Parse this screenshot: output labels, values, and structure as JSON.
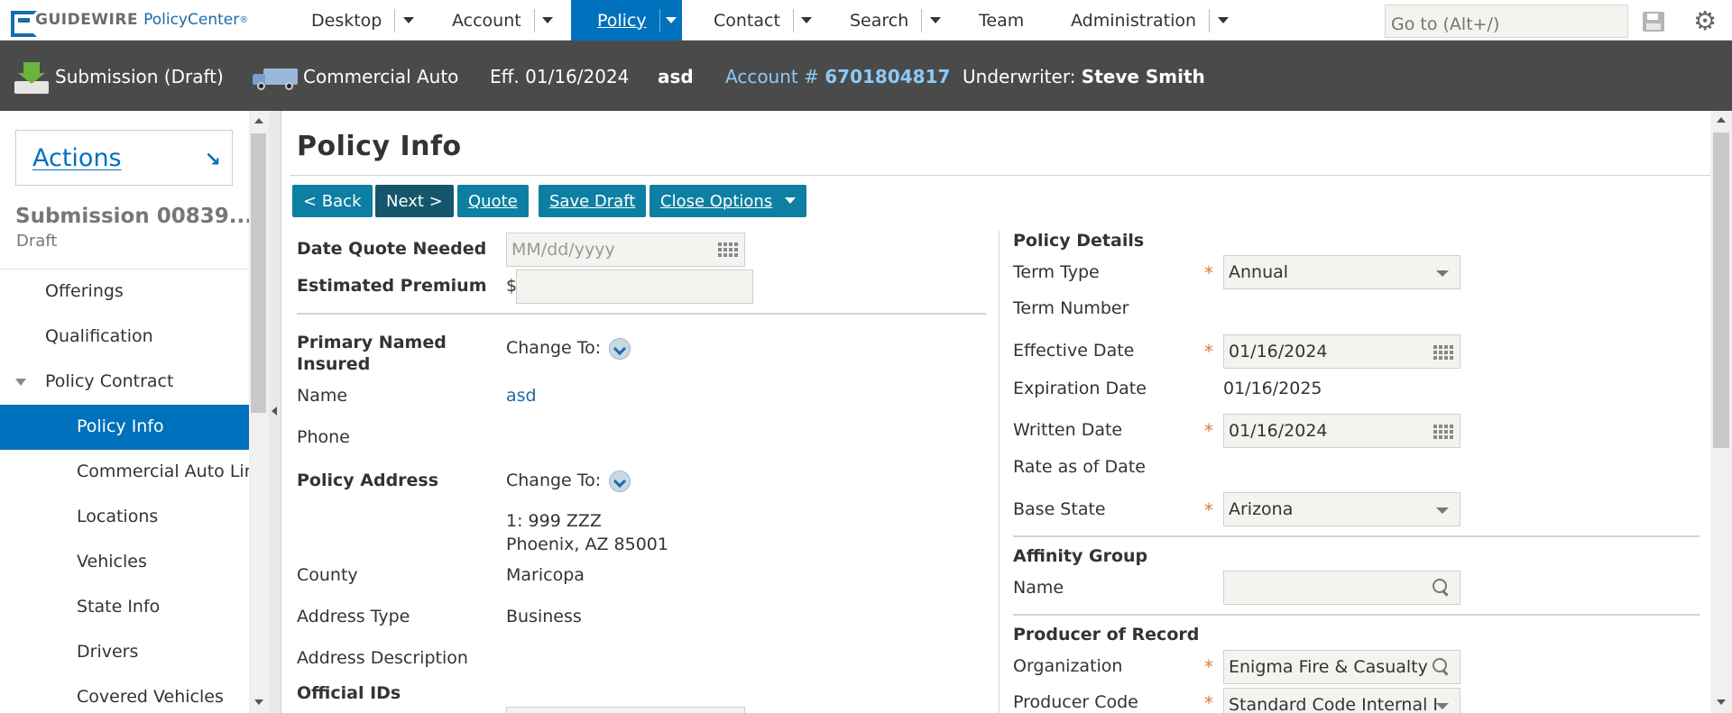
{
  "brand": {
    "name_a": "GUIDEWIRE",
    "name_b": "PolicyCenter",
    "mark": "®"
  },
  "nav": {
    "tabs": [
      {
        "label": "Desktop",
        "has_menu": true
      },
      {
        "label": "Account",
        "has_menu": true
      },
      {
        "label": "Policy",
        "has_menu": true,
        "active": true
      },
      {
        "label": "Contact",
        "has_menu": true
      },
      {
        "label": "Search",
        "has_menu": true
      },
      {
        "label": "Team",
        "has_menu": false
      },
      {
        "label": "Administration",
        "has_menu": true
      }
    ],
    "goto_placeholder": "Go to (Alt+/)",
    "active_color": "#0071bc"
  },
  "infobar": {
    "submission": "Submission (Draft)",
    "product": "Commercial Auto",
    "effective": "Eff. 01/16/2024",
    "insured": "asd",
    "account_label": "Account #",
    "account_number": "6701804817",
    "underwriter_label": "Underwriter:",
    "underwriter_name": "Steve Smith"
  },
  "sidebar": {
    "actions_label": "Actions",
    "submission_title": "Submission 00839...",
    "submission_status": "Draft",
    "items": [
      {
        "label": "Offerings"
      },
      {
        "label": "Qualification"
      },
      {
        "label": "Policy Contract"
      },
      {
        "label": "Policy Info"
      },
      {
        "label": "Commercial Auto Line"
      },
      {
        "label": "Locations"
      },
      {
        "label": "Vehicles"
      },
      {
        "label": "State Info"
      },
      {
        "label": "Drivers"
      },
      {
        "label": "Covered Vehicles"
      }
    ]
  },
  "main": {
    "title": "Policy Info",
    "buttons": {
      "back": "< Back",
      "next": "Next >",
      "quote": "Quote",
      "save_draft": "Save Draft",
      "close_options": "Close Options"
    },
    "left": {
      "date_quote_needed_label": "Date Quote Needed",
      "date_quote_needed_placeholder": "MM/dd/yyyy",
      "estimated_premium_label": "Estimated Premium",
      "currency": "$",
      "primary_named_insured_label": "Primary Named Insured",
      "change_to": "Change To:",
      "name_label": "Name",
      "name_value": "asd",
      "phone_label": "Phone",
      "policy_address_label": "Policy Address",
      "address_line1": "1: 999 ZZZ",
      "address_line2": "Phoenix, AZ 85001",
      "county_label": "County",
      "county_value": "Maricopa",
      "address_type_label": "Address Type",
      "address_type_value": "Business",
      "address_description_label": "Address Description",
      "official_ids_label": "Official IDs"
    },
    "right": {
      "policy_details_label": "Policy Details",
      "term_type_label": "Term Type",
      "term_type_value": "Annual",
      "term_number_label": "Term Number",
      "effective_date_label": "Effective Date",
      "effective_date_value": "01/16/2024",
      "expiration_date_label": "Expiration Date",
      "expiration_date_value": "01/16/2025",
      "written_date_label": "Written Date",
      "written_date_value": "01/16/2024",
      "rate_as_of_label": "Rate as of Date",
      "base_state_label": "Base State",
      "base_state_value": "Arizona",
      "affinity_group_label": "Affinity Group",
      "affinity_name_label": "Name",
      "producer_of_record_label": "Producer of Record",
      "organization_label": "Organization",
      "organization_value": "Enigma Fire & Casualty",
      "producer_code_label": "Producer Code",
      "producer_code_value": "Standard Code Internal I",
      "required_mark": "*"
    }
  }
}
